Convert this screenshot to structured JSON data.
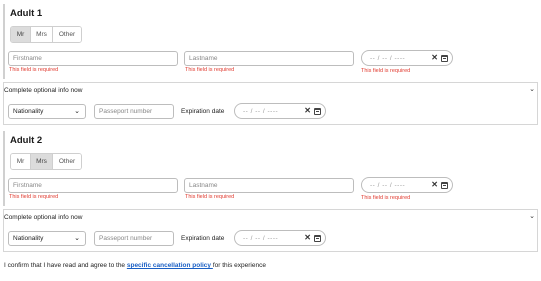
{
  "adults": [
    {
      "title": "Adult 1",
      "salutations": [
        "Mr",
        "Mrs",
        "Other"
      ],
      "selected": 0,
      "firstname_placeholder": "Firstname",
      "lastname_placeholder": "Lastname",
      "firstname_error": "This field is required",
      "lastname_error": "This field is required",
      "birthdate_placeholder": "-- / -- / ----",
      "birthdate_error": "This field is required",
      "optional_label": "Complete optional info now",
      "nationality_label": "Nationality",
      "passport_placeholder": "Passeport number",
      "expiration_label": "Expiration date",
      "expiration_placeholder": "-- / -- / ----"
    },
    {
      "title": "Adult 2",
      "salutations": [
        "Mr",
        "Mrs",
        "Other"
      ],
      "selected": 1,
      "firstname_placeholder": "Firstname",
      "lastname_placeholder": "Lastname",
      "firstname_error": "This field is required",
      "lastname_error": "This field is required",
      "birthdate_placeholder": "-- / -- / ----",
      "birthdate_error": "This field is required",
      "optional_label": "Complete optional info now",
      "nationality_label": "Nationality",
      "passport_placeholder": "Passeport number",
      "expiration_label": "Expiration date",
      "expiration_placeholder": "-- / -- / ----"
    }
  ],
  "confirm": {
    "prefix": "I confirm that I have read and agree to the ",
    "link": "specific cancellation policy ",
    "suffix": "for this experience"
  },
  "icons": {
    "clear": "close-icon",
    "calendar": "calendar-icon",
    "chevron": "chevron-down-icon"
  },
  "colors": {
    "error": "#e03a2f",
    "link": "#1a5fc4",
    "selected_salutation": "#dcdcdc"
  }
}
